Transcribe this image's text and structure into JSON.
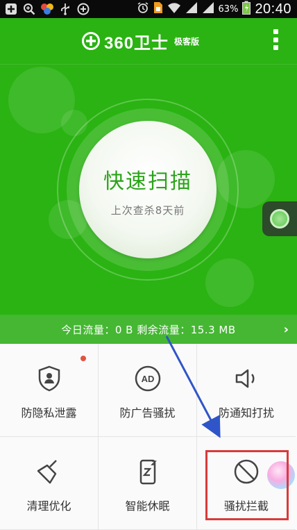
{
  "status_bar": {
    "battery_percent": "63%",
    "time": "20:40",
    "left_icons": [
      "add-icon",
      "search-icon",
      "color-dots-icon",
      "usb-icon",
      "add-circle-icon"
    ],
    "right_icons": [
      "alarm-icon",
      "sim-icon",
      "wifi-icon",
      "signal-icon",
      "signal-icon",
      "battery-icon"
    ]
  },
  "header": {
    "logo_text": "360卫士",
    "logo_sub": "极客版"
  },
  "scan": {
    "title": "快速扫描",
    "subtitle": "上次查杀8天前"
  },
  "traffic": {
    "text": "今日流量：0 B   剩余流量：15.3 MB"
  },
  "grid": {
    "items": [
      {
        "label": "防隐私泄露",
        "icon": "shield-user-icon"
      },
      {
        "label": "防广告骚扰",
        "icon": "ad-icon"
      },
      {
        "label": "防通知打扰",
        "icon": "speaker-icon"
      },
      {
        "label": "清理优化",
        "icon": "broom-icon"
      },
      {
        "label": "智能休眠",
        "icon": "sleep-phone-icon"
      },
      {
        "label": "骚扰拦截",
        "icon": "block-icon"
      }
    ]
  },
  "colors": {
    "brand_green": "#2ab312",
    "annotation_red": "#d93a3a",
    "annotation_blue": "#2f55c9"
  }
}
